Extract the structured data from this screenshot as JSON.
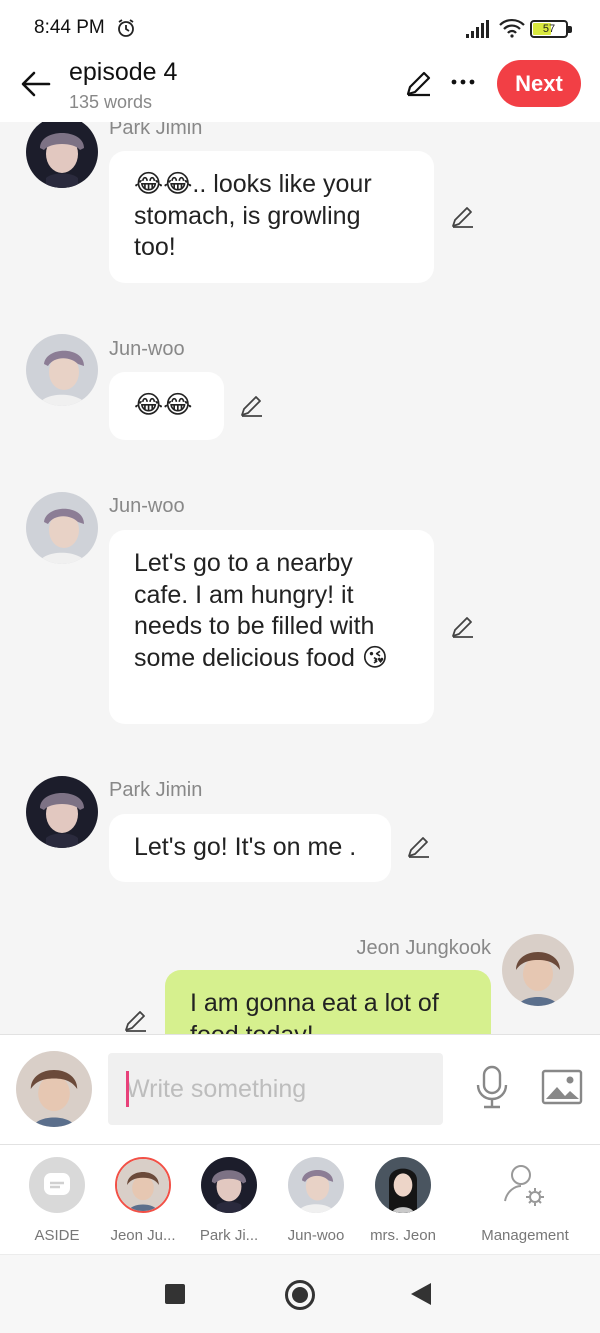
{
  "status_bar": {
    "time": "8:44 PM",
    "battery": "57",
    "battery_level": 0.57
  },
  "header": {
    "title": "episode 4",
    "subtitle": "135 words",
    "next_label": "Next"
  },
  "messages": [
    {
      "sender": "Park Jimin",
      "text": "😂😂.. looks like your stomach, is growling too!"
    },
    {
      "sender": "Jun-woo",
      "text": "😂😂"
    },
    {
      "sender": "Jun-woo",
      "text": "Let's go to a nearby cafe. I am hungry! it needs to be filled with some delicious food 😘"
    },
    {
      "sender": "Park Jimin",
      "text": "Let's go! It's on me ."
    },
    {
      "sender": "Jeon Jungkook",
      "text": "I am gonna eat a lot of food today!"
    }
  ],
  "input": {
    "placeholder": "Write something"
  },
  "characters": [
    {
      "label": "ASIDE"
    },
    {
      "label": "Jeon Ju..."
    },
    {
      "label": "Park Ji..."
    },
    {
      "label": "Jun-woo"
    },
    {
      "label": "mrs. Jeon"
    },
    {
      "label": "Management"
    }
  ],
  "colors": {
    "accent": "#f23f45",
    "my_bubble": "#d6f08e",
    "caret": "#e8417a"
  }
}
